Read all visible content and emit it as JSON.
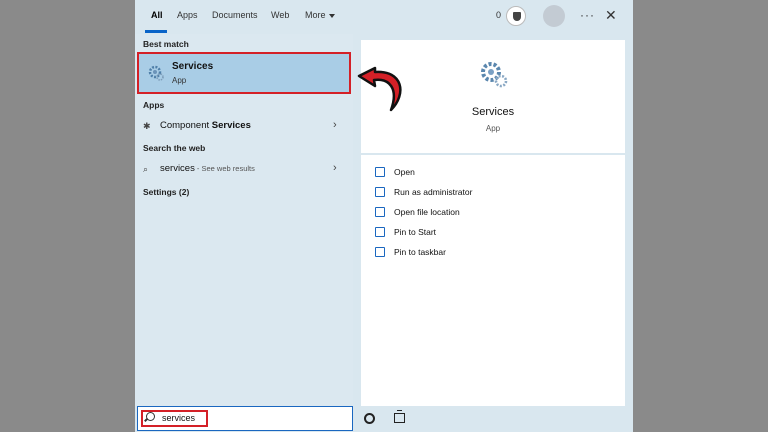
{
  "tabs": [
    {
      "label": "All"
    },
    {
      "label": "Apps"
    },
    {
      "label": "Documents"
    },
    {
      "label": "Web"
    },
    {
      "label": "More"
    }
  ],
  "header": {
    "reward_count": "0",
    "more_options": "···",
    "close": "✕"
  },
  "sections": {
    "best_match": "Best match",
    "apps": "Apps",
    "search_web": "Search the web",
    "settings": "Settings (2)"
  },
  "best_match": {
    "title": "Services",
    "subtitle": "App"
  },
  "apps": [
    {
      "prefix": "Component ",
      "bold": "Services"
    }
  ],
  "web": {
    "query": "services",
    "hint": " - See web results"
  },
  "preview": {
    "title": "Services",
    "subtitle": "App",
    "actions": [
      {
        "label": "Open",
        "icon": "open-icon"
      },
      {
        "label": "Run as administrator",
        "icon": "admin-icon"
      },
      {
        "label": "Open file location",
        "icon": "file-location-icon"
      },
      {
        "label": "Pin to Start",
        "icon": "pin-icon"
      },
      {
        "label": "Pin to taskbar",
        "icon": "pin-icon"
      }
    ]
  },
  "search": {
    "value": "services"
  },
  "colors": {
    "accent": "#0a64c8",
    "highlight": "#d42027",
    "selected": "#a9cde6"
  }
}
